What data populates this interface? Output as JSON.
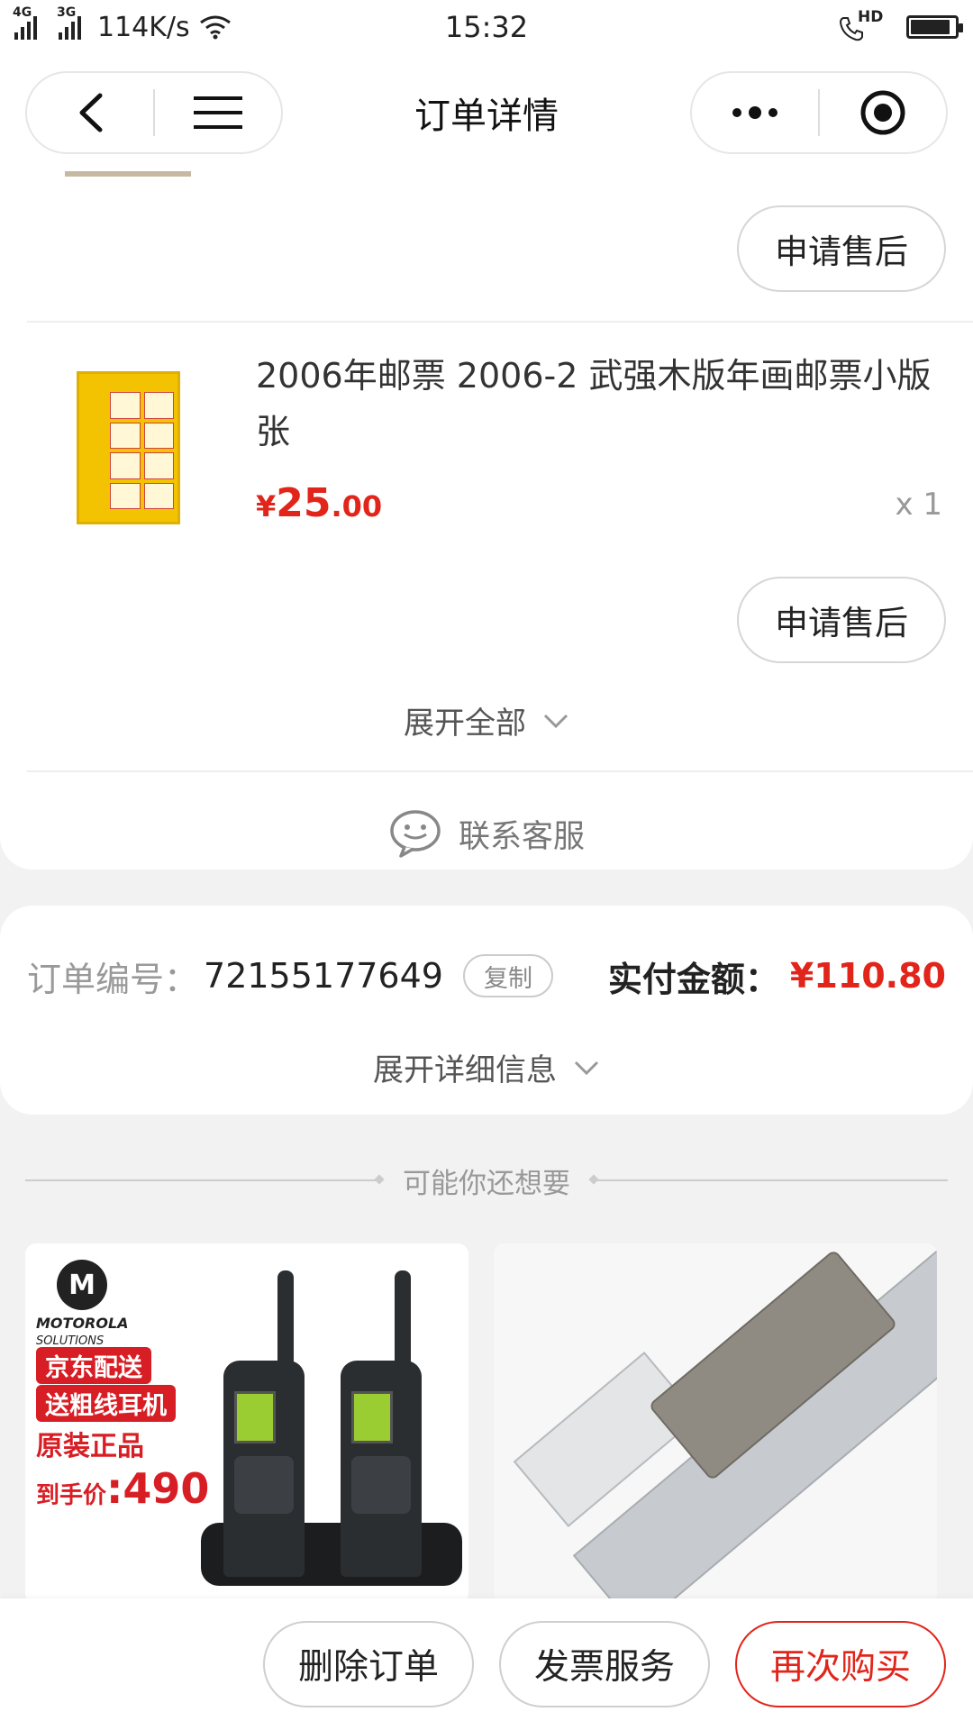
{
  "status_bar": {
    "network_1": "4G",
    "network_2": "3G",
    "speed": "114K/s",
    "time": "15:32",
    "hd_label": "HD",
    "battery_level": 0.9
  },
  "nav": {
    "title": "订单详情",
    "icons": [
      "back-arrow-icon",
      "menu-icon",
      "more-dots-icon",
      "target-icon"
    ]
  },
  "product_1": {
    "aftersale_label": "申请售后"
  },
  "product_2": {
    "title": "2006年邮票 2006-2 武强木版年画邮票小版张",
    "currency": "¥",
    "price_int": "25",
    "price_dec": ".00",
    "qty": "x 1",
    "aftersale_label": "申请售后"
  },
  "expand_all_label": "展开全部",
  "contact_label": "联系客服",
  "order": {
    "number_label": "订单编号：",
    "number": "72155177649",
    "copy_label": "复制",
    "paid_label": "实付金额：",
    "paid_amount": "¥110.80",
    "expand_detail_label": "展开详细信息"
  },
  "recommend": {
    "header": "可能你还想要",
    "item_1": {
      "brand_logo": "M",
      "brand_name": "MOTOROLA",
      "brand_sub": "SOLUTIONS",
      "tag_1": "京东配送",
      "tag_2": "送粗线耳机",
      "tag_3": "原装正品",
      "price_prefix": "到手价",
      "price": ":490"
    }
  },
  "bottom_bar": {
    "delete_label": "删除订单",
    "invoice_label": "发票服务",
    "rebuy_label": "再次购买"
  },
  "colors": {
    "accent_red": "#e1251b",
    "background": "#f2f2f2"
  }
}
